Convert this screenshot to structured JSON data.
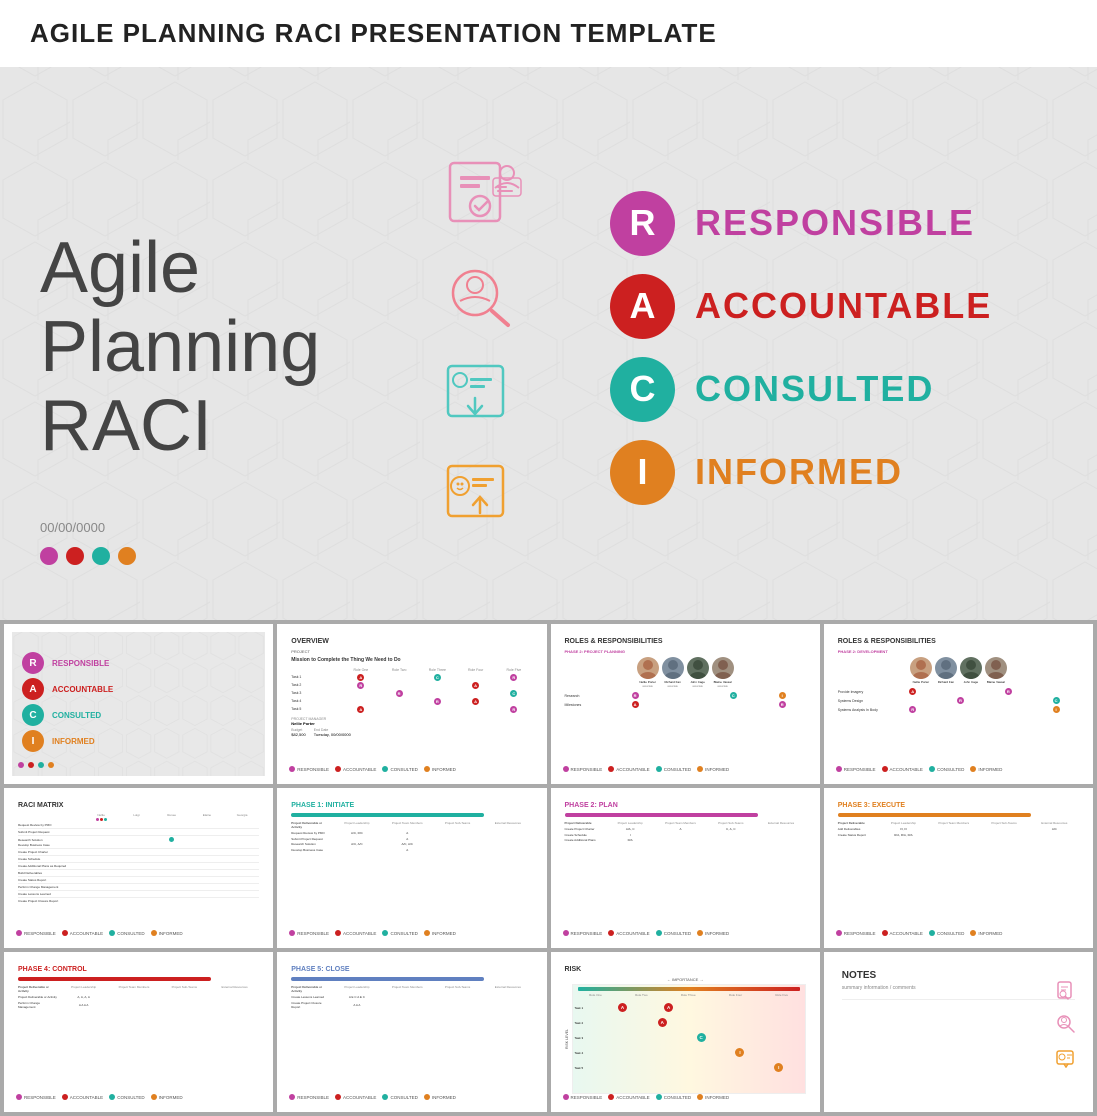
{
  "page": {
    "title": "AGILE PLANNING RACI PRESENTATION TEMPLATE"
  },
  "main_slide": {
    "title_text": "Agile Planning RACI",
    "date": "00/00/0000",
    "raci": {
      "R": {
        "label": "RESPONSIBLE",
        "color": "#c040a0",
        "bg": "#c040a0"
      },
      "A": {
        "label": "ACCOUNTABLE",
        "color": "#cc2020",
        "bg": "#cc2020"
      },
      "C": {
        "label": "CONSULTED",
        "color": "#20b0a0",
        "bg": "#20b0a0"
      },
      "I": {
        "label": "INFORMED",
        "color": "#e08020",
        "bg": "#e08020"
      }
    },
    "dots": [
      "#c040a0",
      "#cc2020",
      "#20b0a0",
      "#e08020"
    ]
  },
  "thumbnails": [
    {
      "id": "slide-1",
      "title": ""
    },
    {
      "id": "slide-overview",
      "title": "OVERVIEW"
    },
    {
      "id": "slide-roles-1",
      "title": "ROLES & RESPONSIBILITIES"
    },
    {
      "id": "slide-roles-2",
      "title": "ROLES & RESPONSIBILITIES"
    },
    {
      "id": "slide-matrix",
      "title": "RACI MATRIX"
    },
    {
      "id": "slide-phase1",
      "title": "PHASE 1: INITIATE"
    },
    {
      "id": "slide-phase2",
      "title": "PHASE 2: PLAN"
    },
    {
      "id": "slide-phase3",
      "title": "PHASE 3: EXECUTE"
    },
    {
      "id": "slide-phase4",
      "title": "PHASE 4: CONTROL"
    },
    {
      "id": "slide-phase5",
      "title": "PHASE 5: CLOSE"
    },
    {
      "id": "slide-risk",
      "title": "RISK"
    },
    {
      "id": "slide-notes",
      "title": "NOTES"
    }
  ],
  "overview": {
    "project_label": "PROJECT",
    "project_name": "Mission to Complete the Thing We Need to Do",
    "pm_label": "PROJECT MANAGER",
    "pm_name": "Nellie Porter",
    "budget_label": "Budget",
    "budget_value": "$82,500",
    "end_label": "End Date",
    "end_value": "Tuesday, 00/00/0000"
  },
  "notes": {
    "title": "NOTES",
    "subtitle": "summary information / comments"
  },
  "colors": {
    "responsible": "#c040a0",
    "accountable": "#cc2020",
    "consulted": "#20b0a0",
    "informed": "#e08020",
    "phase1": "#20b0a0",
    "phase2": "#c040a0",
    "phase3": "#e08020",
    "phase4": "#cc2020",
    "phase5": "#6080c0"
  },
  "footer_labels": {
    "responsible": "RESPONSIBLE",
    "accountable": "ACCOUNTABLE",
    "consulted": "CONSULTED",
    "informed": "INFORMED"
  }
}
